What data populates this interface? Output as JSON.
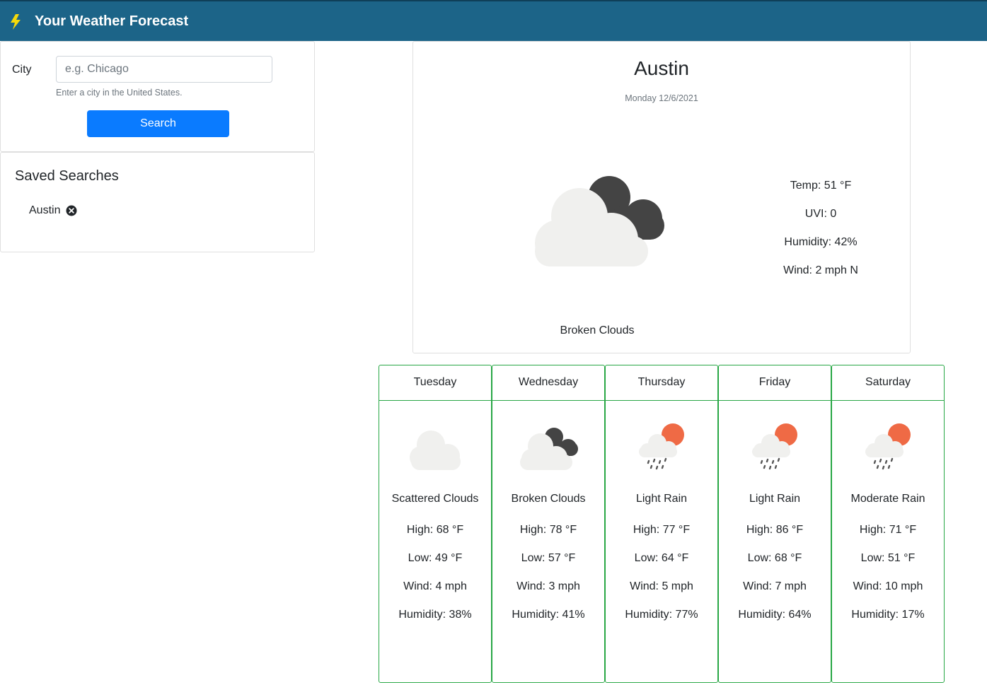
{
  "app": {
    "title": "Your Weather Forecast"
  },
  "search": {
    "city_label": "City",
    "placeholder": "e.g. Chicago",
    "value": "",
    "help_text": "Enter a city in the United States.",
    "button_label": "Search"
  },
  "saved": {
    "title": "Saved Searches",
    "items": [
      {
        "label": "Austin"
      }
    ]
  },
  "current": {
    "city": "Austin",
    "date": "Monday 12/6/2021",
    "temp": "Temp: 51 °F",
    "uvi": "UVI: 0",
    "humidity": "Humidity: 42%",
    "wind": "Wind: 2 mph N",
    "description": "Broken Clouds",
    "icon": "broken-clouds-icon"
  },
  "forecast": [
    {
      "day": "Tuesday",
      "icon": "scattered-clouds-icon",
      "description": "Scattered Clouds",
      "high": "High: 68 °F",
      "low": "Low: 49 °F",
      "wind": "Wind: 4 mph",
      "humidity": "Humidity: 38%"
    },
    {
      "day": "Wednesday",
      "icon": "broken-clouds-icon",
      "description": "Broken Clouds",
      "high": "High: 78 °F",
      "low": "Low: 57 °F",
      "wind": "Wind: 3 mph",
      "humidity": "Humidity: 41%"
    },
    {
      "day": "Thursday",
      "icon": "light-rain-icon",
      "description": "Light Rain",
      "high": "High: 77 °F",
      "low": "Low: 64 °F",
      "wind": "Wind: 5 mph",
      "humidity": "Humidity: 77%"
    },
    {
      "day": "Friday",
      "icon": "light-rain-icon",
      "description": "Light Rain",
      "high": "High: 86 °F",
      "low": "Low: 68 °F",
      "wind": "Wind: 7 mph",
      "humidity": "Humidity: 64%"
    },
    {
      "day": "Saturday",
      "icon": "moderate-rain-icon",
      "description": "Moderate Rain",
      "high": "High: 71 °F",
      "low": "Low: 51 °F",
      "wind": "Wind: 10 mph",
      "humidity": "Humidity: 17%"
    }
  ],
  "colors": {
    "navbar": "#1c6488",
    "bolt": "#f5d90a",
    "button": "#0a7bff",
    "forecast_border": "#28a745",
    "sun": "#ef6a45",
    "dark_cloud": "#444444",
    "light_cloud": "#f0f0ee"
  }
}
